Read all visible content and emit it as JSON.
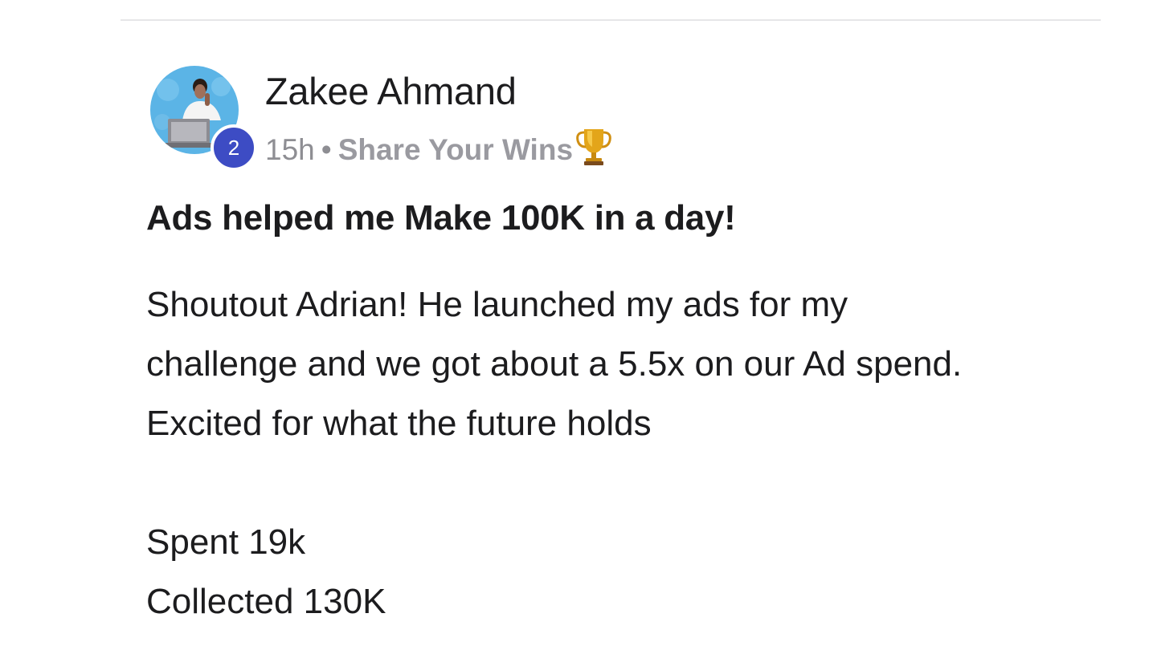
{
  "post": {
    "author": {
      "name": "Zakee Ahmand",
      "level": "2",
      "avatar_icon": "user-avatar-photo"
    },
    "time_ago": "15h",
    "separator": "•",
    "category": "Share Your Wins",
    "category_icon": "trophy-icon",
    "title": "Ads helped me Make 100K in a day!",
    "body_lines": [
      "Shoutout Adrian! He launched my ads for my",
      "challenge and we got about a 5.5x on our Ad spend.",
      "Excited for what the future holds"
    ],
    "stats_lines": [
      "Spent 19k",
      "Collected 130K"
    ]
  },
  "colors": {
    "level_badge": "#3d4cc4",
    "meta_text": "#8e8e93",
    "divider": "#e6e6e8"
  }
}
